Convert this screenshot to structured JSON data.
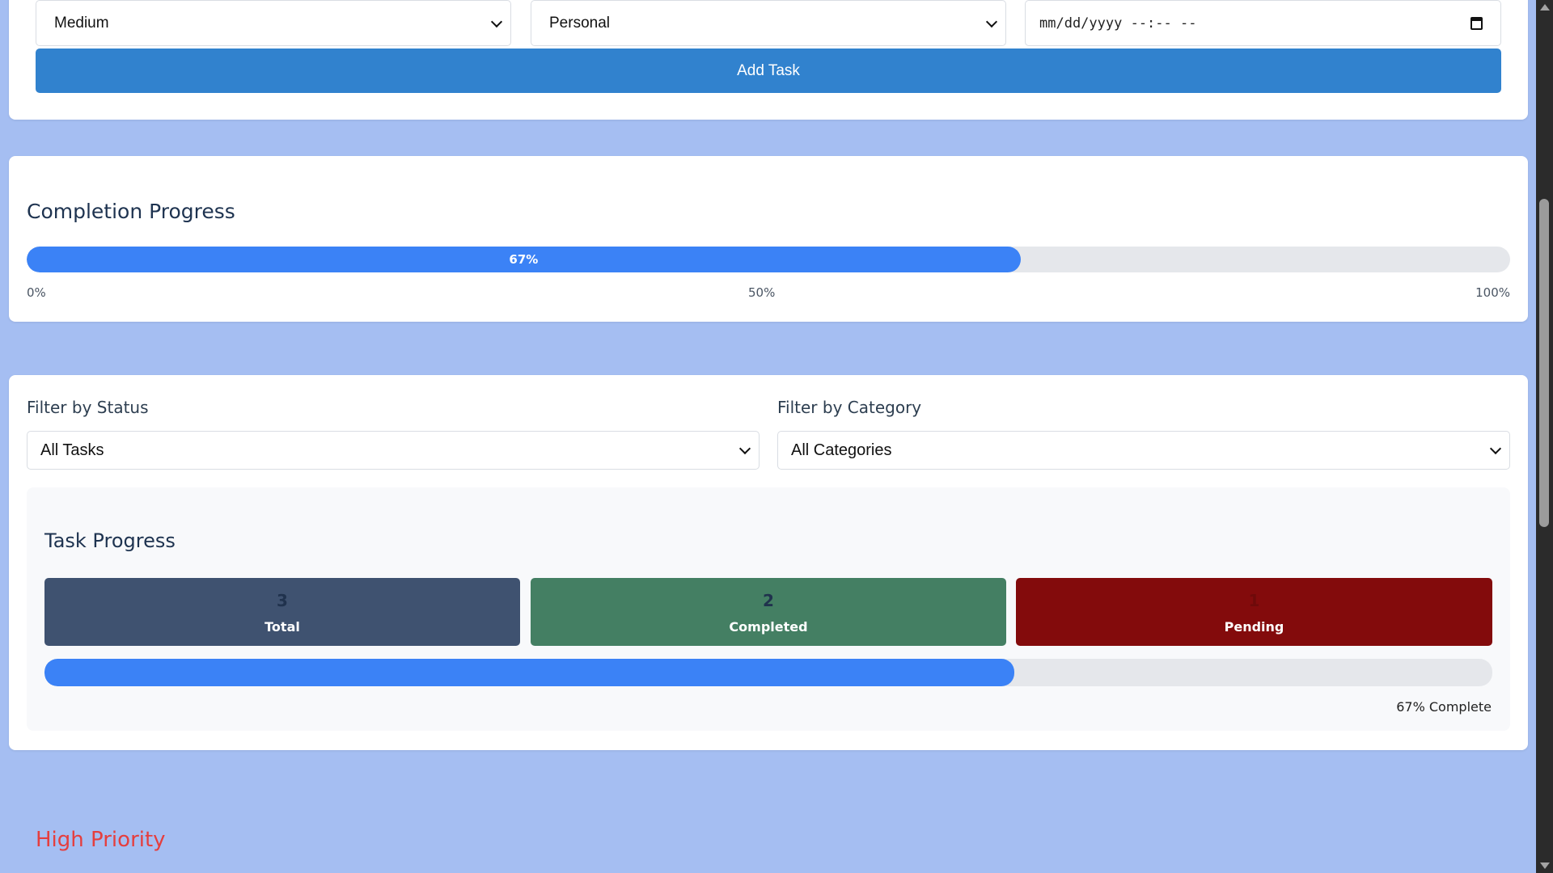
{
  "task_form": {
    "priority_select": {
      "value": "Medium"
    },
    "category_select": {
      "value": "Personal"
    },
    "due_date_input": {
      "placeholder": "mm/dd/yyyy --:-- --"
    },
    "add_button_label": "Add Task"
  },
  "completion_progress": {
    "title": "Completion Progress",
    "percent": 67,
    "percent_label": "67%",
    "ticks": [
      "0%",
      "50%",
      "100%"
    ]
  },
  "filters": {
    "status_label": "Filter by Status",
    "status_value": "All Tasks",
    "category_label": "Filter by Category",
    "category_value": "All Categories"
  },
  "task_progress": {
    "title": "Task Progress",
    "stats": [
      {
        "value": "3",
        "label": "Total",
        "color": "#3f5270",
        "num_color": "#20324d"
      },
      {
        "value": "2",
        "label": "Completed",
        "color": "#447f63",
        "num_color": "#20324d"
      },
      {
        "value": "1",
        "label": "Pending",
        "color": "#830b0c",
        "num_color": "#6e0a0a"
      }
    ],
    "percent": 67,
    "complete_text": "67% Complete"
  },
  "sections": {
    "high_priority_title": "High Priority"
  },
  "colors": {
    "page_background": "#a5bef2",
    "primary_button": "#3182ce",
    "progress_fill": "#3b82f6",
    "track": "#e5e7eb",
    "high_priority_text": "#e53e3e"
  }
}
